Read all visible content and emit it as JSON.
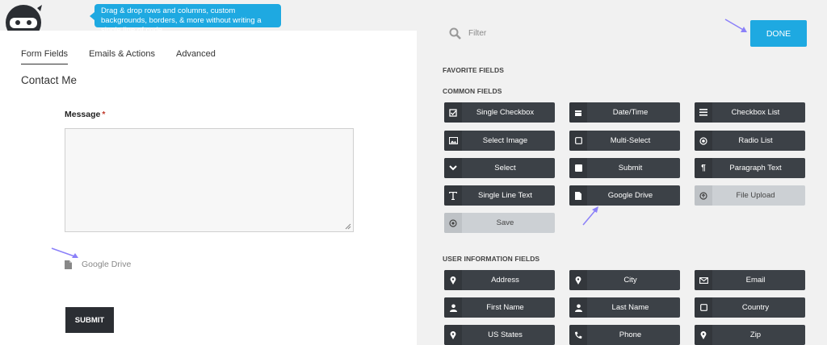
{
  "tooltip": {
    "text": "Drag & drop rows and columns, custom backgrounds, borders, & more without writing a single line of code."
  },
  "tabs": [
    {
      "label": "Form Fields"
    },
    {
      "label": "Emails & Actions"
    },
    {
      "label": "Advanced"
    }
  ],
  "form": {
    "title": "Contact Me",
    "message_label": "Message",
    "required_mark": "*",
    "google_drive_label": "Google Drive",
    "submit_label": "SUBMIT"
  },
  "drawer": {
    "filter_placeholder": "Filter",
    "done_label": "DONE",
    "favorite_heading": "FAVORITE FIELDS",
    "common_heading": "COMMON FIELDS",
    "user_info_heading": "USER INFORMATION FIELDS",
    "common_fields": [
      {
        "label": "Single Checkbox",
        "icon": "checkbox-icon"
      },
      {
        "label": "Date/Time",
        "icon": "calendar-icon"
      },
      {
        "label": "Checkbox List",
        "icon": "list-icon"
      },
      {
        "label": "Select Image",
        "icon": "image-icon"
      },
      {
        "label": "Multi-Select",
        "icon": "square-icon"
      },
      {
        "label": "Radio List",
        "icon": "radio-icon"
      },
      {
        "label": "Select",
        "icon": "chevron-down-icon"
      },
      {
        "label": "Submit",
        "icon": "filled-square-icon"
      },
      {
        "label": "Paragraph Text",
        "icon": "paragraph-icon"
      },
      {
        "label": "Single Line Text",
        "icon": "text-icon"
      },
      {
        "label": "Google Drive",
        "icon": "file-icon"
      },
      {
        "label": "File Upload",
        "icon": "upload-icon"
      },
      {
        "label": "Save",
        "icon": "save-icon"
      }
    ],
    "user_fields": [
      {
        "label": "Address",
        "icon": "map-pin-icon"
      },
      {
        "label": "City",
        "icon": "map-pin-icon"
      },
      {
        "label": "Email",
        "icon": "envelope-icon"
      },
      {
        "label": "First Name",
        "icon": "user-icon"
      },
      {
        "label": "Last Name",
        "icon": "user-icon"
      },
      {
        "label": "Country",
        "icon": "square-icon"
      },
      {
        "label": "US States",
        "icon": "map-pin-icon"
      },
      {
        "label": "Phone",
        "icon": "phone-icon"
      },
      {
        "label": "Zip",
        "icon": "map-pin-icon"
      }
    ]
  },
  "colors": {
    "accent": "#1ea9e1",
    "field_bg": "#3c4147",
    "field_disabled": "#ccd0d4",
    "arrow": "#8b80f9"
  }
}
